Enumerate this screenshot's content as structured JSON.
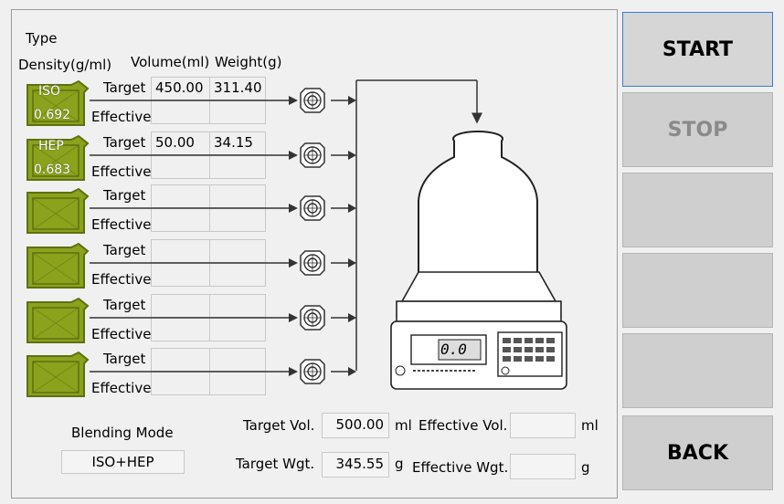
{
  "header": {
    "type_label": "Type",
    "density_label": "Density(g/ml)",
    "volume_label": "Volume(ml)",
    "weight_label": "Weight(g)"
  },
  "rows": [
    {
      "type": "ISO",
      "density": "0.692",
      "target_label": "Target",
      "effective_label": "Effective",
      "target_volume": "450.00",
      "target_weight": "311.40",
      "effective_volume": "",
      "effective_weight": ""
    },
    {
      "type": "HEP",
      "density": "0.683",
      "target_label": "Target",
      "effective_label": "Effective",
      "target_volume": "50.00",
      "target_weight": "34.15",
      "effective_volume": "",
      "effective_weight": ""
    },
    {
      "type": "",
      "density": "",
      "target_label": "Target",
      "effective_label": "Effective",
      "target_volume": "",
      "target_weight": "",
      "effective_volume": "",
      "effective_weight": ""
    },
    {
      "type": "",
      "density": "",
      "target_label": "Target",
      "effective_label": "Effective",
      "target_volume": "",
      "target_weight": "",
      "effective_volume": "",
      "effective_weight": ""
    },
    {
      "type": "",
      "density": "",
      "target_label": "Target",
      "effective_label": "Effective",
      "target_volume": "",
      "target_weight": "",
      "effective_volume": "",
      "effective_weight": ""
    },
    {
      "type": "",
      "density": "",
      "target_label": "Target",
      "effective_label": "Effective",
      "target_volume": "",
      "target_weight": "",
      "effective_volume": "",
      "effective_weight": ""
    }
  ],
  "blending": {
    "mode_label": "Blending Mode",
    "mode_value": "ISO+HEP"
  },
  "totals": {
    "target_vol_label": "Target Vol.",
    "target_vol_value": "500.00",
    "target_vol_unit": "ml",
    "effective_vol_label": "Effective Vol.",
    "effective_vol_value": "",
    "effective_vol_unit": "ml",
    "target_wgt_label": "Target Wgt.",
    "target_wgt_value": "345.55",
    "target_wgt_unit": "g",
    "effective_wgt_label": "Effective Wgt.",
    "effective_wgt_value": "",
    "effective_wgt_unit": "g"
  },
  "scale": {
    "display": "0.0"
  },
  "buttons": {
    "start": "START",
    "stop": "STOP",
    "blank1": "",
    "blank2": "",
    "blank3": "",
    "back": "BACK"
  },
  "colors": {
    "can": "#8aa21c",
    "can_dark": "#5e7010",
    "accent": "#3a7bd5"
  },
  "icons": [
    "fuel-can-icon",
    "pump-icon",
    "arrow-icon",
    "bottle-icon",
    "scale-icon"
  ]
}
